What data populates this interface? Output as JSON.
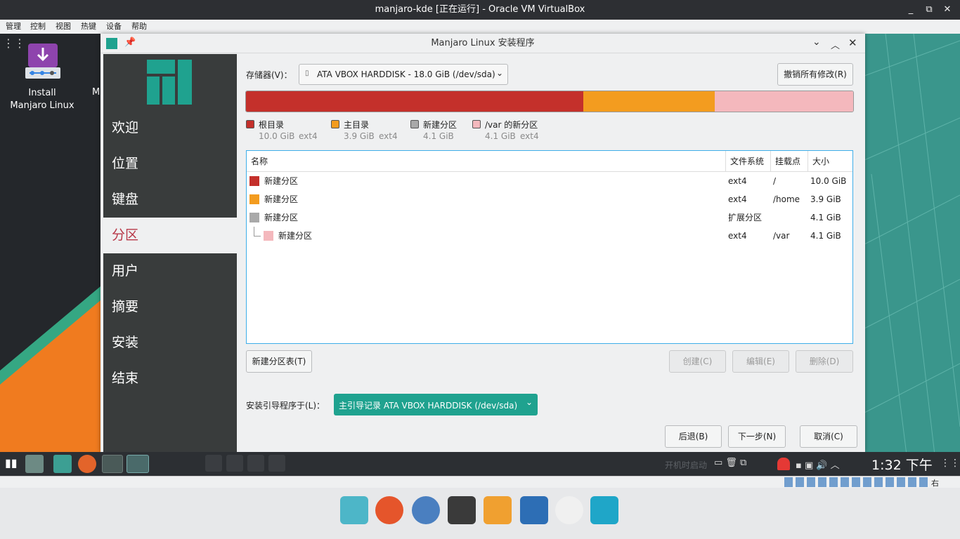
{
  "vbox": {
    "title": "manjaro-kde [正在运行] - Oracle VM VirtualBox",
    "menu": [
      "管理",
      "控制",
      "视图",
      "热键",
      "设备",
      "帮助"
    ]
  },
  "desktop": {
    "icon_label_line1": "Install",
    "icon_label_line2": "Manjaro Linux",
    "partial_label": "M"
  },
  "installer": {
    "title": "Manjaro Linux 安装程序",
    "sidebar": [
      {
        "label": "欢迎"
      },
      {
        "label": "位置"
      },
      {
        "label": "键盘"
      },
      {
        "label": "分区"
      },
      {
        "label": "用户"
      },
      {
        "label": "摘要"
      },
      {
        "label": "安装"
      },
      {
        "label": "结束"
      }
    ],
    "storage_label": "存储器(V)：",
    "storage_value": "ATA VBOX HARDDISK - 18.0 GiB (/dev/sda)",
    "revert_button": "撤销所有修改(R)",
    "usage_bar": {
      "segments": [
        {
          "name": "根目录",
          "size_gib": 10.0,
          "color": "#c4302b"
        },
        {
          "name": "主目录",
          "size_gib": 3.9,
          "color": "#f39c1f"
        },
        {
          "name": "/var 的新分区",
          "size_gib": 4.1,
          "color": "#f4b8bd"
        }
      ]
    },
    "legend": [
      {
        "name": "根目录",
        "size": "10.0 GiB",
        "fs": "ext4",
        "color": "#c4302b"
      },
      {
        "name": "主目录",
        "size": "3.9 GiB",
        "fs": "ext4",
        "color": "#f39c1f"
      },
      {
        "name": "新建分区",
        "size": "4.1 GiB",
        "fs": "",
        "color": "#a9a9a9"
      },
      {
        "name": "/var 的新分区",
        "size": "4.1 GiB",
        "fs": "ext4",
        "color": "#f4b8bd"
      }
    ],
    "table": {
      "headers": [
        "名称",
        "文件系统",
        "挂载点",
        "大小"
      ],
      "rows": [
        {
          "name": "新建分区",
          "fs": "ext4",
          "mount": "/",
          "size": "10.0 GiB",
          "color": "#c4302b"
        },
        {
          "name": "新建分区",
          "fs": "ext4",
          "mount": "/home",
          "size": "3.9 GiB",
          "color": "#f39c1f"
        },
        {
          "name": "新建分区",
          "fs": "扩展分区",
          "mount": "",
          "size": "4.1 GiB",
          "color": "#a9a9a9"
        },
        {
          "name": "新建分区",
          "fs": "ext4",
          "mount": "/var",
          "size": "4.1 GiB",
          "color": "#f4b8bd"
        }
      ]
    },
    "new_table_button": "新建分区表(T)",
    "create_button": "创建(C)",
    "edit_button": "编辑(E)",
    "delete_button": "删除(D)",
    "bootloader_label": "安装引导程序于(L)：",
    "bootloader_value": "主引导记录 ATA VBOX HARDDISK (/dev/sda)",
    "back_button": "后退(B)",
    "next_button": "下一步(N)",
    "cancel_button": "取消(C)"
  },
  "taskbar": {
    "startup_text": "开机时启动",
    "clock": "1:32 下午"
  },
  "vbox_status": {
    "host_key": "右 Ctrl"
  },
  "colors": {
    "accent": "#1fa28f",
    "sidebar": "#393c3c",
    "active_text": "#b73848"
  }
}
